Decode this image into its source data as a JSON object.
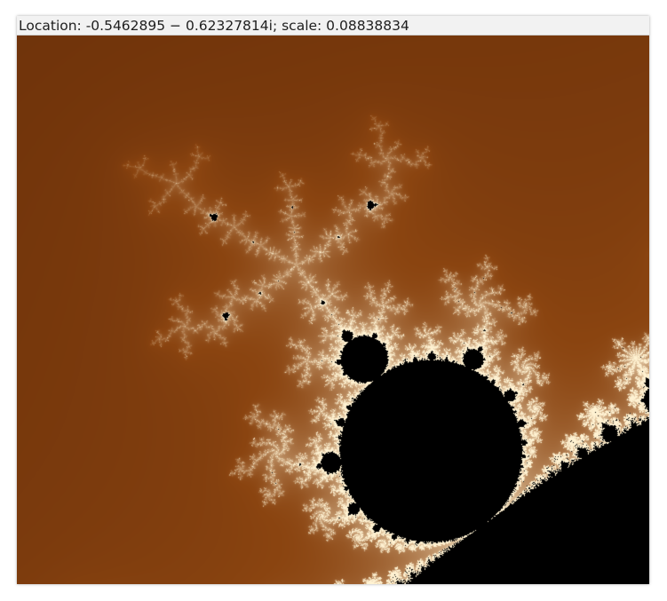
{
  "status_bar": {
    "location_text": "Location: -0.5462895 − 0.62327814i; scale: 0.08838834"
  },
  "fractal": {
    "type": "mandelbrot",
    "center_re": -0.5462895,
    "center_im": -0.62327814,
    "scale": 0.08838834,
    "interior_color": "#000000",
    "exterior_dark_color": "#3d1300",
    "exterior_mid_color": "#8a4410",
    "boundary_glow_color": "#fff2d2"
  }
}
